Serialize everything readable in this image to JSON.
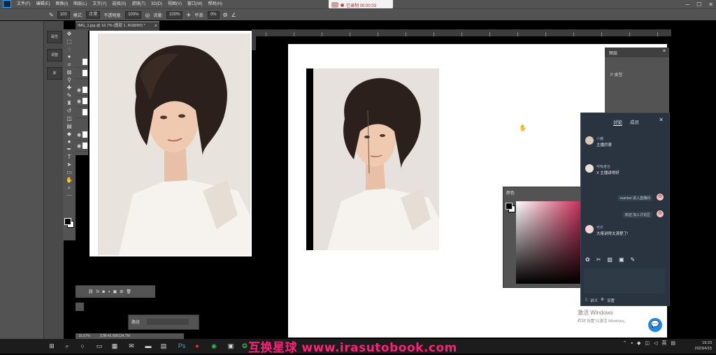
{
  "app": {
    "menus": [
      "文件(F)",
      "编辑(E)",
      "图像(I)",
      "图层(L)",
      "文字(Y)",
      "选择(S)",
      "滤镜(T)",
      "3D(D)",
      "视图(V)",
      "窗口(W)",
      "帮助(H)"
    ]
  },
  "meeting": {
    "timer": "已录制 00:00:03"
  },
  "options": {
    "mode_label": "模式:",
    "mode_value": "正常",
    "opacity_label": "不透明度:",
    "opacity_value": "100%",
    "flow_label": "流量:",
    "flow_value": "100%",
    "smooth_label": "平滑:",
    "smooth_value": "0%",
    "size_value": "100"
  },
  "left_panel": {
    "buttons": [
      "属性",
      "调整",
      "库"
    ]
  },
  "document": {
    "tab_title": "IMG_1.jpg @ 16.7% (图层 1, RGB/8#) *"
  },
  "status": {
    "zoom": "16.67%",
    "doc_info": "文档:45.6M/134.7M"
  },
  "float_panel": {
    "title": "路径"
  },
  "color_panel": {
    "title": "颜色"
  },
  "right_panel": {
    "title": "图层",
    "subtitle": "P 类型"
  },
  "chat": {
    "tabs": [
      "讨论",
      "成员"
    ],
    "messages": [
      {
        "name": "小鹿",
        "text": "主播厉害"
      },
      {
        "name": "呼吸者在",
        "text": "X 主播讲得好"
      },
      {
        "name": "可乐",
        "text": "大佬讲得太清楚了!"
      }
    ],
    "system_messages": [
      "xuanlan 进入直播间",
      "欢迎 加入讨论区"
    ],
    "bottom_links": [
      "讲义",
      "设置"
    ]
  },
  "activate": {
    "line1": "激活 Windows",
    "line2": "转到\"设置\"以激活 Windows。"
  },
  "watermark": {
    "text": "互换星球 www.irasutobook.com"
  },
  "clock": {
    "time": "19:23",
    "date": "2023/4/15"
  }
}
